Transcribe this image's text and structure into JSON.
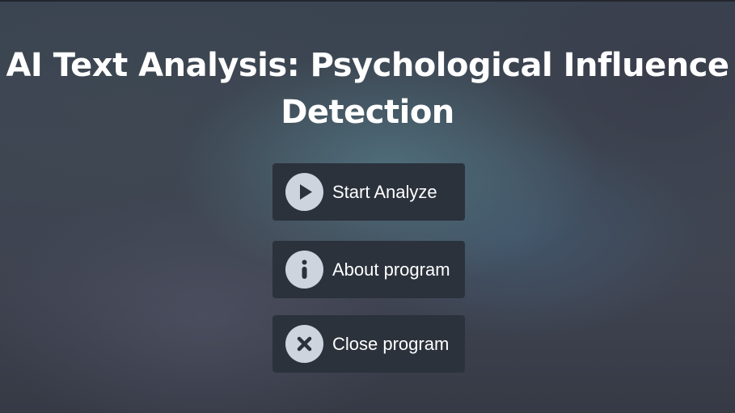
{
  "app": {
    "title": "AI Text Analysis: Psychological Influence Detection"
  },
  "menu": {
    "start": {
      "label": "Start Analyze",
      "icon": "play-icon"
    },
    "about": {
      "label": "About program",
      "icon": "info-icon"
    },
    "close": {
      "label": "Close program",
      "icon": "close-icon"
    }
  },
  "colors": {
    "button_bg": "#2b323c",
    "icon_bg": "#ced4de",
    "icon_glyph": "#2b323c",
    "text": "#ffffff"
  }
}
